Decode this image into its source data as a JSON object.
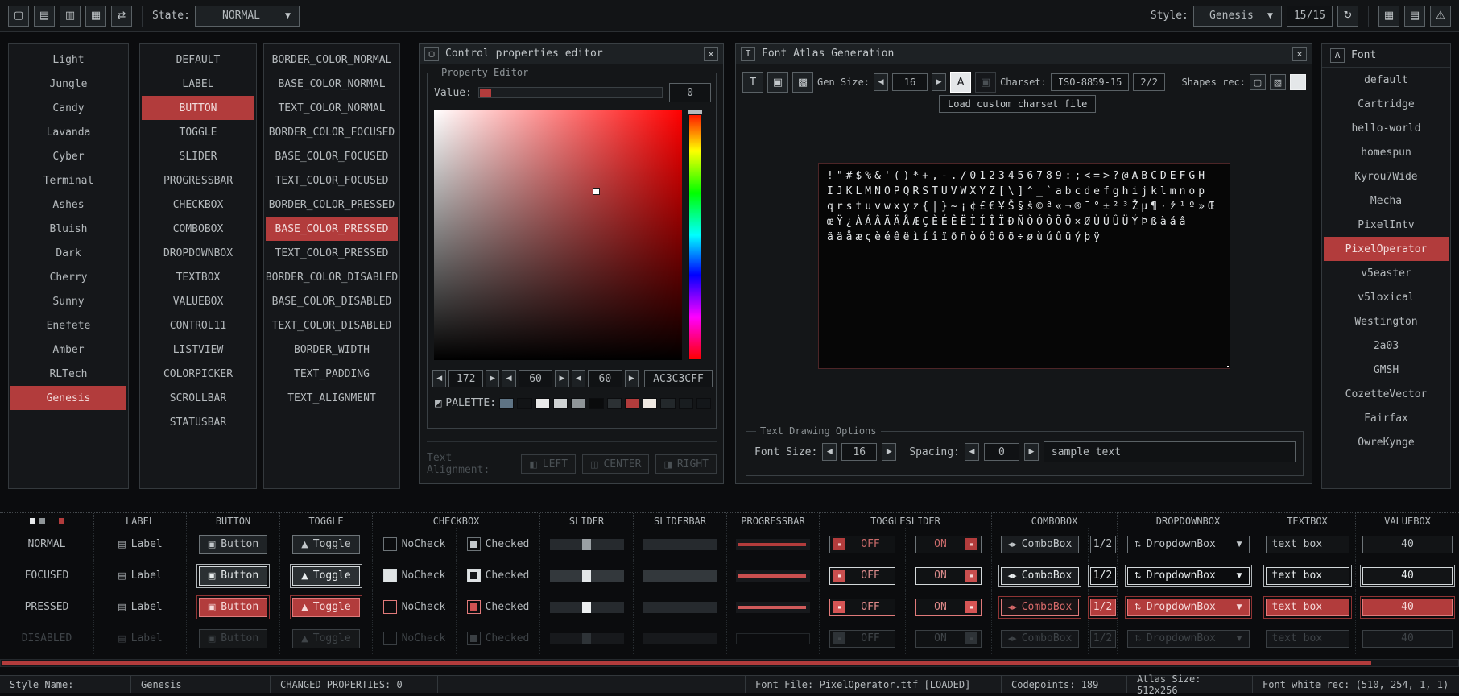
{
  "toolbar": {
    "state_label": "State:",
    "state_value": "NORMAL",
    "style_label": "Style:",
    "style_value": "Genesis",
    "style_count": "15/15"
  },
  "icons": {
    "new": "▢",
    "open": "▤",
    "save": "▥",
    "export": "▦",
    "random": "⇄",
    "reload": "↻",
    "grid": "▦",
    "sheet": "▤",
    "warn": "⚠",
    "close": "×",
    "caret": "▼",
    "left": "◀",
    "right": "▶",
    "window": "▢",
    "t": "T",
    "a": "A",
    "image": "▣",
    "image2": "▩",
    "box": "▢",
    "hatch": "▨",
    "label": "▤",
    "button": "▣",
    "toggle": "▲",
    "combo": "◂▸",
    "updown": "⇅",
    "knob": "▪",
    "palette": "◩",
    "align_left": "◧",
    "align_center": "◫",
    "align_right": "◨",
    "font": "A"
  },
  "styles": {
    "items": [
      "Light",
      "Jungle",
      "Candy",
      "Lavanda",
      "Cyber",
      "Terminal",
      "Ashes",
      "Bluish",
      "Dark",
      "Cherry",
      "Sunny",
      "Enefete",
      "Amber",
      "RLTech",
      "Genesis"
    ]
  },
  "controls": {
    "items": [
      "DEFAULT",
      "LABEL",
      "BUTTON",
      "TOGGLE",
      "SLIDER",
      "PROGRESSBAR",
      "CHECKBOX",
      "COMBOBOX",
      "DROPDOWNBOX",
      "TEXTBOX",
      "VALUEBOX",
      "CONTROL11",
      "LISTVIEW",
      "COLORPICKER",
      "SCROLLBAR",
      "STATUSBAR"
    ]
  },
  "properties": {
    "items": [
      "BORDER_COLOR_NORMAL",
      "BASE_COLOR_NORMAL",
      "TEXT_COLOR_NORMAL",
      "BORDER_COLOR_FOCUSED",
      "BASE_COLOR_FOCUSED",
      "TEXT_COLOR_FOCUSED",
      "BORDER_COLOR_PRESSED",
      "BASE_COLOR_PRESSED",
      "TEXT_COLOR_PRESSED",
      "BORDER_COLOR_DISABLED",
      "BASE_COLOR_DISABLED",
      "TEXT_COLOR_DISABLED",
      "BORDER_WIDTH",
      "TEXT_PADDING",
      "TEXT_ALIGNMENT"
    ]
  },
  "editor": {
    "title": "Control properties editor",
    "group": "Property Editor",
    "value_label": "Value:",
    "value": "0",
    "r": "172",
    "g": "60",
    "b": "60",
    "hex": "AC3C3CFF",
    "palette_label": "PALETTE:",
    "palette": [
      "#5f7485",
      "#121416",
      "#e9e9e9",
      "#cfd2d3",
      "#8f9598",
      "#0a0b0c",
      "#2c3134",
      "#b23c3c",
      "#efe9e2",
      "#23282b",
      "#191d20",
      "#14171a"
    ],
    "align_label": "Text Alignment:",
    "left": "LEFT",
    "center": "CENTER",
    "right": "RIGHT"
  },
  "atlas": {
    "title": "Font Atlas Generation",
    "gen_label": "Gen Size:",
    "gen_size": "16",
    "charset_label": "Charset:",
    "charset": "ISO-8859-15",
    "charset_count": "2/2",
    "shapes_label": "Shapes rec:",
    "tooltip": "Load custom charset file",
    "lines": [
      "!\"#$%&'()*+,-./0123456789:;<=>?@ABCDEFGH",
      "IJKLMNOPQRSTUVWXYZ[\\]^_`abcdefghijklmnop",
      "qrstuvwxyz{|}~¡¢£€¥Š§š©ª«¬®¯°±²³Žµ¶·ž¹º»Œ",
      "œŸ¿ÀÁÂÃÄÅÆÇÈÉÊËÌÍÎÏÐÑÒÓÔÕÖ×ØÙÚÛÜÝÞßàáâ",
      "ãäåæçèéêëìíîïðñòóôõö÷øùúûüýþÿ"
    ],
    "options_title": "Text Drawing Options",
    "fs_label": "Font Size:",
    "fs": "16",
    "sp_label": "Spacing:",
    "sp": "0",
    "sample": "sample text"
  },
  "fonts": {
    "header": "Font",
    "items": [
      "default",
      "Cartridge",
      "hello-world",
      "homespun",
      "Kyrou7Wide",
      "Mecha",
      "PixelIntv",
      "PixelOperator",
      "v5easter",
      "v5loxical",
      "Westington",
      "2a03",
      "GMSH",
      "CozetteVector",
      "Fairfax",
      "OwreKynge"
    ]
  },
  "table": {
    "columns": [
      "",
      "LABEL",
      "BUTTON",
      "TOGGLE",
      "CHECKBOX",
      "SLIDER",
      "SLIDERBAR",
      "PROGRESSBAR",
      "TOGGLESLIDER",
      "COMBOBOX",
      "DROPDOWNBOX",
      "TEXTBOX",
      "VALUEBOX"
    ],
    "rows": [
      "NORMAL",
      "FOCUSED",
      "PRESSED",
      "DISABLED"
    ],
    "w": {
      "label": "Label",
      "button": "Button",
      "toggle": "Toggle",
      "nocheck": "NoCheck",
      "checked": "Checked",
      "off": "OFF",
      "on": "ON",
      "combo": "ComboBox",
      "count": "1/2",
      "dropdown": "DropdownBox",
      "textbox": "text box",
      "valuebox": "40"
    },
    "swatches": [
      "#e8eaec",
      "#8f9598",
      "#0c0d0e",
      "#b23c3c"
    ]
  },
  "status": {
    "name_label": "Style Name:",
    "name": "Genesis",
    "changed": "CHANGED PROPERTIES: 0",
    "font_file": "Font File: PixelOperator.ttf [LOADED]",
    "codepoints": "Codepoints: 189",
    "atlas_size": "Atlas Size: 512x256",
    "white_rec": "Font white rec: (510, 254, 1, 1)"
  },
  "colors": {
    "accent": "#b23c3c",
    "selected_text": "#f2dcdc"
  }
}
